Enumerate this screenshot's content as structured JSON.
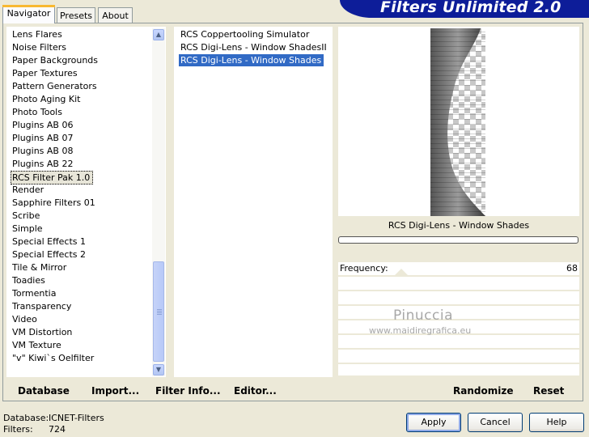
{
  "tabs": [
    {
      "label": "Navigator"
    },
    {
      "label": "Presets"
    },
    {
      "label": "About"
    }
  ],
  "banner": {
    "title": "Filters Unlimited 2.0",
    "color": "#0d1d99"
  },
  "categories": [
    "Lens Flares",
    "Noise Filters",
    "Paper Backgrounds",
    "Paper Textures",
    "Pattern Generators",
    "Photo Aging Kit",
    "Photo Tools",
    "Plugins AB 06",
    "Plugins AB 07",
    "Plugins AB 08",
    "Plugins AB 22",
    "RCS Filter Pak 1.0",
    "Render",
    "Sapphire Filters 01",
    "Scribe",
    "Simple",
    "Special Effects 1",
    "Special Effects 2",
    "Tile & Mirror",
    "Toadies",
    "Tormentia",
    "Transparency",
    "Video",
    "VM Distortion",
    "VM Texture",
    "\"v\" Kiwi`s Oelfilter"
  ],
  "selected_category": "RCS Filter Pak 1.0",
  "filters": [
    "RCS Coppertooling Simulator",
    "RCS Digi-Lens - Window ShadesII",
    "RCS Digi-Lens - Window Shades"
  ],
  "selected_filter": "RCS Digi-Lens - Window Shades",
  "preview": {
    "filter_name": "RCS Digi-Lens - Window Shades"
  },
  "params": [
    {
      "label": "Frequency:",
      "value": "68"
    }
  ],
  "watermark": {
    "name": "Pinuccia",
    "url": "www.maidiregrafica.eu"
  },
  "bottom_buttons": {
    "database": "Database",
    "import": "Import...",
    "filter_info": "Filter Info...",
    "editor": "Editor...",
    "randomize": "Randomize",
    "reset": "Reset"
  },
  "status": {
    "database_label": "Database:",
    "database_value": "ICNET-Filters",
    "filters_label": "Filters:",
    "filters_value": "724"
  },
  "dialog_buttons": {
    "apply": "Apply",
    "cancel": "Cancel",
    "help": "Help"
  }
}
